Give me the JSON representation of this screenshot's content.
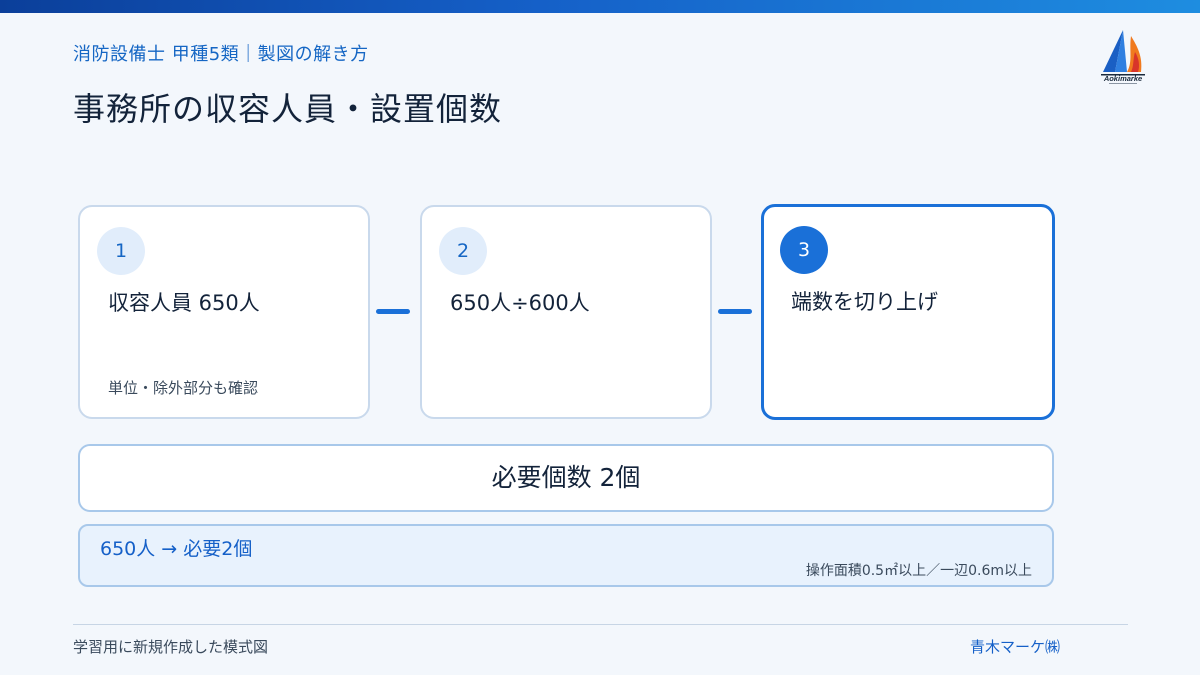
{
  "header": {
    "subtitle": "消防設備士 甲種5類｜製図の解き方",
    "title": "事務所の収容人員・設置個数"
  },
  "logo": {
    "icon": "flame-mountain-logo",
    "text": "Aokimarke",
    "colors": {
      "blue": "#1a5fc4",
      "orange": "#f07a1f",
      "red": "#d8352a"
    }
  },
  "steps": [
    {
      "number": "1",
      "text": "収容人員 650人",
      "note": "単位・除外部分も確認"
    },
    {
      "number": "2",
      "text": "650人÷600人",
      "note": ""
    },
    {
      "number": "3",
      "text": "端数を切り上げ",
      "note": ""
    }
  ],
  "result": {
    "label": "必要個数 2個"
  },
  "detail": {
    "summary": "650人 → 必要2個",
    "note": "操作面積0.5㎡以上／一辺0.6m以上"
  },
  "footer": {
    "left": "学習用に新規作成した模式図",
    "right": "青木マーケ㈱"
  },
  "colors": {
    "accent": "#1a70d8",
    "accent_text": "#1566c4",
    "background": "#f3f7fc"
  }
}
